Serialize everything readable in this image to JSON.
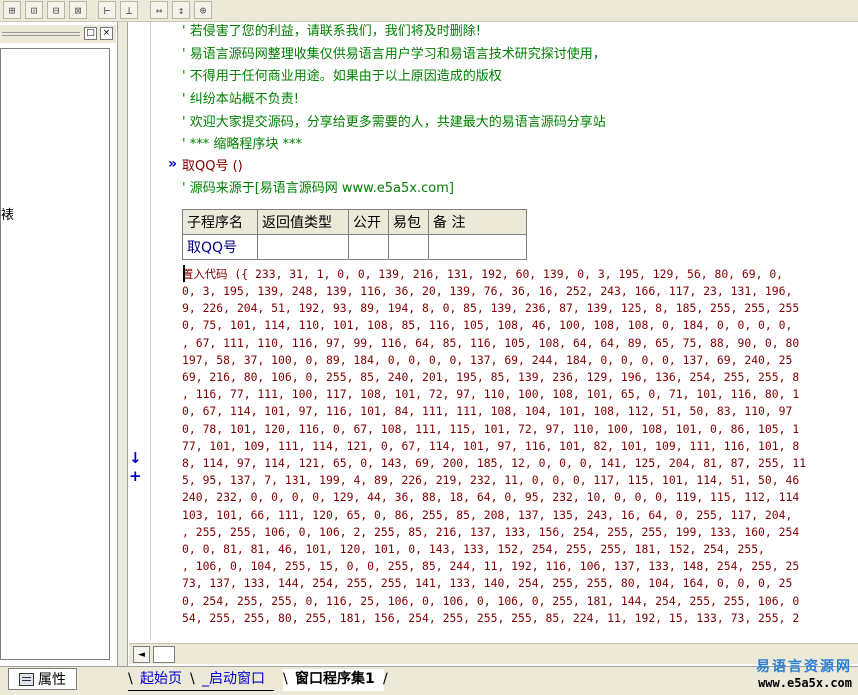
{
  "toolbar": {
    "icons": [
      "align-left-icon",
      "align-center-icon",
      "align-top-icon",
      "align-middle-icon",
      "same-width-icon",
      "same-height-icon",
      "h-spacing-icon",
      "v-spacing-icon",
      "center-grid-icon"
    ],
    "glyphs": [
      "⊞",
      "⊡",
      "⊟",
      "⊠",
      "⊢",
      "⊥",
      "↔",
      "↕",
      "⊕"
    ]
  },
  "left_panel": {
    "restore_label": "□",
    "close_label": "×",
    "clipped_text": "裱"
  },
  "editor": {
    "comments": [
      "' 若侵害了您的利益，请联系我们，我们将及时删除!",
      "' 易语言源码网整理收集仅供易语言用户学习和易语言技术研究探讨使用，",
      "' 不得用于任何商业用途。如果由于以上原因造成的版权",
      "' 纠纷本站概不负责!",
      "' 欢迎大家提交源码，分享给更多需要的人，共建最大的易语言源码分享站"
    ],
    "fold_marker": "»",
    "fold_comment": "' *** 缩略程序块 ***",
    "assembly_name": "取QQ号 ()",
    "source_comment": "' 源码来源于[易语言源码网 www.e5a5x.com]",
    "table": {
      "headers": [
        "子程序名",
        "返回值类型",
        "公开",
        "易包",
        "备 注"
      ],
      "rows": [
        [
          "取QQ号",
          "",
          "",
          "",
          ""
        ]
      ]
    },
    "left_marks": "↓ +",
    "data_lines": [
      "置入代码 ({ 233, 31, 1, 0, 0, 139, 216, 131, 192, 60, 139, 0, 3, 195, 129, 56, 80, 69, 0,",
      "0, 3, 195, 139, 248, 139, 116, 36, 20, 139, 76, 36, 16, 252, 243, 166, 117, 23, 131, 196,",
      "9, 226, 204, 51, 192, 93, 89, 194, 8, 0, 85, 139, 236, 87, 139, 125, 8, 185, 255, 255, 255",
      "0, 75, 101, 114, 110, 101, 108, 85, 116, 105, 108, 46, 100, 108, 108, 0, 184, 0, 0, 0, 0,",
      ", 67, 111, 110, 116, 97, 99, 116, 64, 85, 116, 105, 108, 64, 64, 89, 65, 75, 88, 90, 0, 80",
      " 197, 58, 37, 100, 0, 89, 184, 0, 0, 0, 0, 137, 69, 244, 184, 0, 0, 0, 0, 137, 69, 240, 25",
      "69, 216, 80, 106, 0, 255, 85, 240, 201, 195, 85, 139, 236, 129, 196, 136, 254, 255, 255, 8",
      ", 116, 77, 111, 100, 117, 108, 101, 72, 97, 110, 100, 108, 101, 65, 0, 71, 101, 116, 80, 1",
      " 0, 67, 114, 101, 97, 116, 101, 84, 111, 111, 108, 104, 101, 108, 112, 51, 50, 83, 110, 97",
      " 0, 78, 101, 120, 116, 0, 67, 108, 111, 115, 101, 72, 97, 110, 100, 108, 101, 0, 86, 105, 1",
      " 77, 101, 109, 111, 114, 121, 0, 67, 114, 101, 97, 116, 101, 82, 101, 109, 111, 116, 101, 8",
      "8, 114, 97, 114, 121, 65, 0, 143, 69, 200, 185, 12, 0, 0, 0, 141, 125, 204, 81, 87, 255, 11",
      "5, 95, 137, 7, 131, 199, 4, 89, 226, 219, 232, 11, 0, 0, 0, 117, 115, 101, 114, 51, 50, 46",
      "240, 232, 0, 0, 0, 0, 129, 44, 36, 88, 18, 64, 0, 95, 232, 10, 0, 0, 0, 119, 115, 112, 114",
      "103, 101, 66, 111, 120, 65, 0, 86, 255, 85, 208, 137, 135, 243, 16, 64, 0, 255, 117, 204,",
      ", 255, 255, 106, 0, 106, 2, 255, 85, 216, 137, 133, 156, 254, 255, 255, 199, 133, 160, 254",
      "0, 0, 81, 81, 46, 101, 120, 101, 0, 143, 133, 152, 254, 255, 255, 181, 152, 254, 255,",
      ", 106, 0, 104, 255, 15, 0, 0, 255, 85, 244, 11, 192, 116, 106, 137, 133, 148, 254, 255, 25",
      " 73, 137, 133, 144, 254, 255, 255, 141, 133, 140, 254, 255, 255, 80, 104, 164, 0, 0, 0, 25",
      "0, 254, 255, 255, 0, 116, 25, 106, 0, 106, 0, 106, 0, 255, 181, 144, 254, 255, 255, 106, 0",
      "54, 255, 255, 80, 255, 181, 156, 254, 255, 255, 255, 85, 224, 11, 192, 15, 133, 73, 255, 2"
    ]
  },
  "scrollbar": {
    "left_arrow": "◄"
  },
  "bottom": {
    "property_tab": "属性",
    "tabs": [
      {
        "label": "起始页",
        "active": false
      },
      {
        "label": "_启动窗口",
        "active": false
      },
      {
        "label": "窗口程序集1",
        "active": true
      }
    ],
    "watermark_cn": "易语言资源网",
    "watermark_url": "www.e5a5x.com"
  }
}
